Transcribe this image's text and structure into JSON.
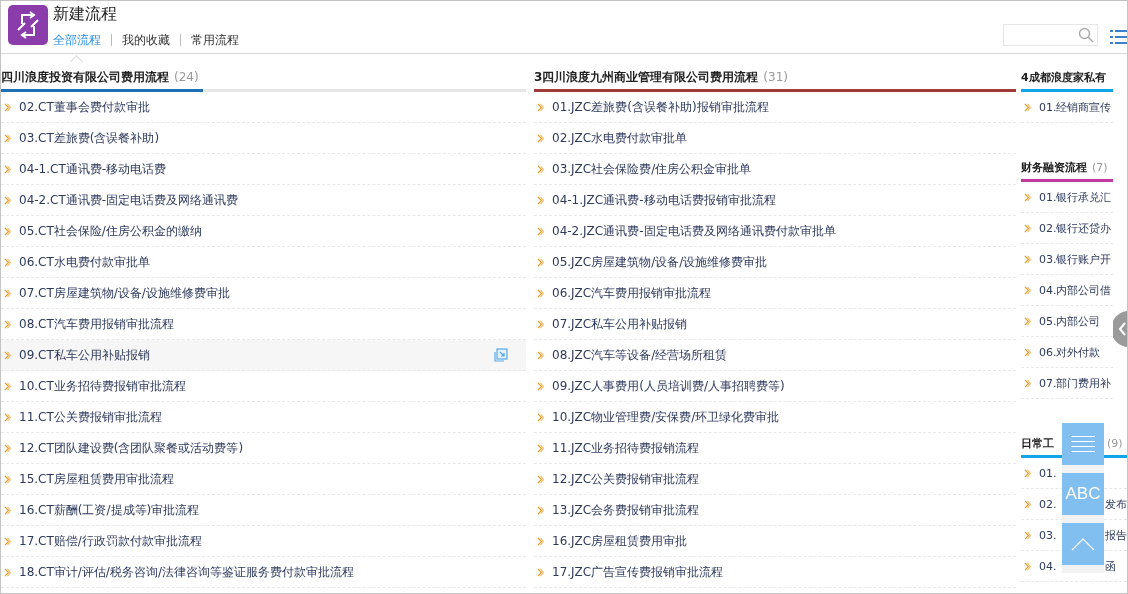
{
  "header": {
    "title": "新建流程",
    "tabs": [
      {
        "label": "全部流程",
        "selected": true
      },
      {
        "label": "我的收藏",
        "selected": false
      },
      {
        "label": "常用流程",
        "selected": false
      }
    ]
  },
  "columns": [
    {
      "sections": [
        {
          "kind": "list",
          "title": "四川浪度投资有限公司费用流程",
          "count": "(24)",
          "color": "#1f6fb5",
          "items": [
            {
              "label": "02.CT董事会费付款审批",
              "highlighted": false
            },
            {
              "label": "03.CT差旅费(含误餐补助)",
              "highlighted": false
            },
            {
              "label": "04-1.CT通讯费-移动电话费",
              "highlighted": false
            },
            {
              "label": "04-2.CT通讯费-固定电话费及网络通讯费",
              "highlighted": false
            },
            {
              "label": "05.CT社会保险/住房公积金的缴纳",
              "highlighted": false
            },
            {
              "label": "06.CT水电费付款审批单",
              "highlighted": false
            },
            {
              "label": "07.CT房屋建筑物/设备/设施维修费审批",
              "highlighted": false
            },
            {
              "label": "08.CT汽车费用报销审批流程",
              "highlighted": false
            },
            {
              "label": "09.CT私车公用补贴报销",
              "highlighted": true
            },
            {
              "label": "10.CT业务招待费报销审批流程",
              "highlighted": false
            },
            {
              "label": "11.CT公关费报销审批流程",
              "highlighted": false
            },
            {
              "label": "12.CT团队建设费(含团队聚餐或活动费等)",
              "highlighted": false
            },
            {
              "label": "15.CT房屋租赁费用审批流程",
              "highlighted": false
            },
            {
              "label": "16.CT薪酬(工资/提成等)审批流程",
              "highlighted": false
            },
            {
              "label": "17.CT赔偿/行政罚款付款审批流程",
              "highlighted": false
            },
            {
              "label": "18.CT审计/评估/税务咨询/法律咨询等鉴证服务费付款审批流程",
              "highlighted": false
            }
          ]
        }
      ]
    },
    {
      "sections": [
        {
          "kind": "list",
          "title": "3四川浪度九州商业管理有限公司费用流程",
          "count": "(31)",
          "color": "#a33a3a",
          "items": [
            {
              "label": "01.JZC差旅费(含误餐补助)报销审批流程",
              "highlighted": false
            },
            {
              "label": "02.JZC水电费付款审批单",
              "highlighted": false
            },
            {
              "label": "03.JZC社会保险费/住房公积金审批单",
              "highlighted": false
            },
            {
              "label": "04-1.JZC通讯费-移动电话费报销审批流程",
              "highlighted": false
            },
            {
              "label": "04-2.JZC通讯费-固定电话费及网络通讯费付款审批单",
              "highlighted": false
            },
            {
              "label": "05.JZC房屋建筑物/设备/设施维修费审批",
              "highlighted": false
            },
            {
              "label": "06.JZC汽车费用报销审批流程",
              "highlighted": false
            },
            {
              "label": "07.JZC私车公用补贴报销",
              "highlighted": false
            },
            {
              "label": "08.JZC汽车等设备/经营场所租赁",
              "highlighted": false
            },
            {
              "label": "09.JZC人事费用(人员培训费/人事招聘费等)",
              "highlighted": false
            },
            {
              "label": "10.JZC物业管理费/安保费/环卫绿化费审批",
              "highlighted": false
            },
            {
              "label": "11.JZC业务招待费报销流程",
              "highlighted": false
            },
            {
              "label": "12.JZC公关费报销审批流程",
              "highlighted": false
            },
            {
              "label": "13.JZC会务费报销审批流程",
              "highlighted": false
            },
            {
              "label": "16.JZC房屋租赁费用审批",
              "highlighted": false
            },
            {
              "label": "17.JZC广告宣传费报销审批流程",
              "highlighted": false
            }
          ]
        }
      ]
    },
    {
      "sections": [
        {
          "kind": "list",
          "title": "4成都浪度家私有",
          "color": "#10a5e8",
          "items": [
            {
              "label": "01.经销商宣传",
              "highlighted": false
            }
          ]
        },
        {
          "kind": "list",
          "title": "财务融资流程",
          "count": "(7)",
          "color": "#c23a9c",
          "items": [
            {
              "label": "01.银行承兑汇",
              "highlighted": false
            },
            {
              "label": "02.银行还贷办",
              "highlighted": false
            },
            {
              "label": "03.银行账户开",
              "highlighted": false
            },
            {
              "label": "04.内部公司借",
              "highlighted": false
            },
            {
              "label": "05.内部公司",
              "highlighted": false
            },
            {
              "label": "06.对外付款",
              "highlighted": false
            },
            {
              "label": "07.部门费用补",
              "highlighted": false
            }
          ]
        },
        {
          "kind": "covered",
          "title": "日常工",
          "count": "(9)",
          "color": "#10a5e8",
          "items": [
            {
              "label": "01.",
              "highlighted": false
            },
            {
              "label": "02.",
              "tail": "发布",
              "highlighted": false
            },
            {
              "label": "03.",
              "tail": "报告",
              "highlighted": false
            },
            {
              "label": "04.",
              "tail": "函",
              "highlighted": false
            }
          ]
        }
      ]
    }
  ],
  "tools": [
    {
      "kind": "menu"
    },
    {
      "kind": "text",
      "label": "ABC"
    },
    {
      "kind": "top"
    }
  ]
}
